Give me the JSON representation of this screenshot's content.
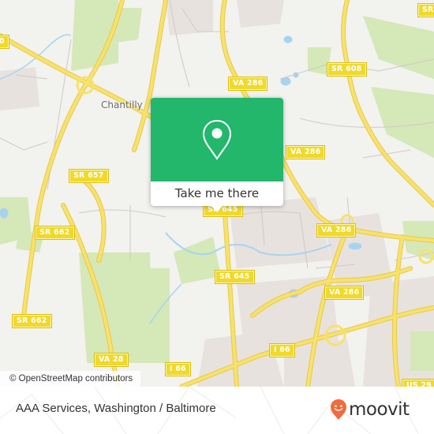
{
  "map": {
    "place_labels": [
      {
        "id": "chantilly",
        "text": "Chantilly"
      }
    ],
    "road_shields": [
      {
        "id": "shield-sr608",
        "text": "SR 608"
      },
      {
        "id": "shield-va286-a",
        "text": "VA 286"
      },
      {
        "id": "shield-va286-b",
        "text": "VA 286"
      },
      {
        "id": "shield-va286-c",
        "text": "VA 286"
      },
      {
        "id": "shield-va286-d",
        "text": "VA 286"
      },
      {
        "id": "shield-sr657",
        "text": "SR 657"
      },
      {
        "id": "shield-sr662-a",
        "text": "SR 662"
      },
      {
        "id": "shield-sr662-b",
        "text": "SR 662"
      },
      {
        "id": "shield-sr645-a",
        "text": "SR 645"
      },
      {
        "id": "shield-sr645-b",
        "text": "SR 645"
      },
      {
        "id": "shield-va28",
        "text": "VA 28"
      },
      {
        "id": "shield-i66-a",
        "text": "I 66"
      },
      {
        "id": "shield-i66-b",
        "text": "I 66"
      },
      {
        "id": "shield-us29",
        "text": "US 29"
      },
      {
        "id": "shield-edge-left",
        "text": "0"
      },
      {
        "id": "shield-edge-right",
        "text": "SR"
      }
    ],
    "attribution": "© OpenStreetMap contributors",
    "colors": {
      "background": "#f2f2ef",
      "road_major": "#f7e26b",
      "park": "#d5e8b8",
      "water": "#a8d3f0",
      "residential": "#e8e2df"
    }
  },
  "popup": {
    "icon": "location-pin-icon",
    "cta_label": "Take me there",
    "color": "#22b76b"
  },
  "footer": {
    "title": "AAA Services, Washington / Baltimore",
    "logo_text": "moovit",
    "logo_icon": "moovit-pin-face-icon",
    "logo_color": "#f26a3d"
  }
}
